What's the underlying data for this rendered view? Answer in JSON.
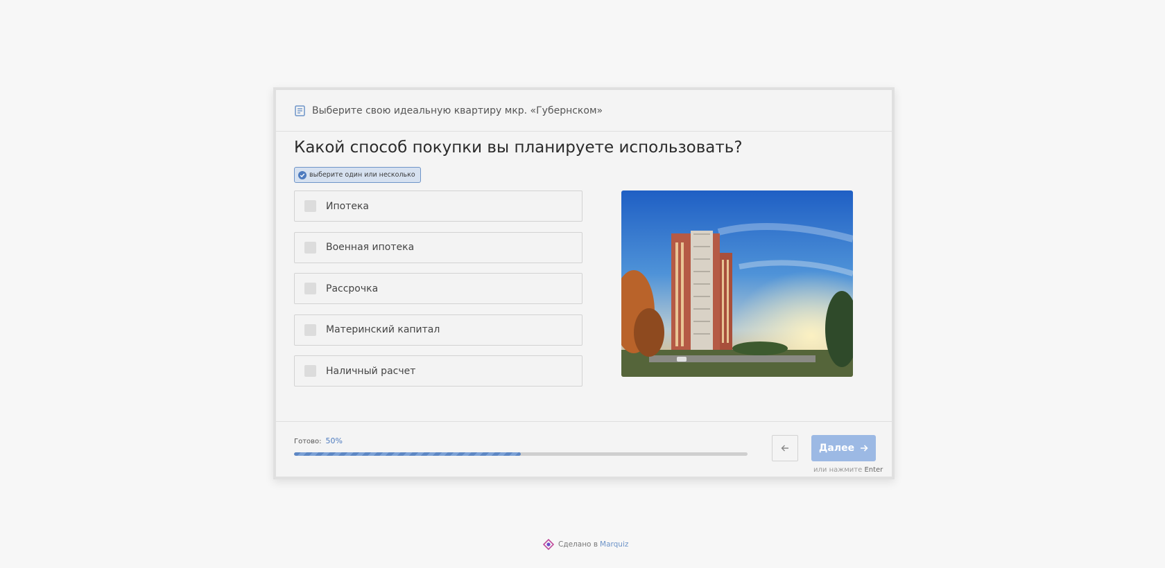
{
  "header": {
    "title": "Выберите свою идеальную квартиру мкр. «Губернском»",
    "icon": "form-list-icon"
  },
  "question": {
    "text": "Какой способ покупки вы планируете использовать?"
  },
  "hint": {
    "text": "выберите один или несколько"
  },
  "options": [
    {
      "label": "Ипотека",
      "checked": false
    },
    {
      "label": "Военная ипотека",
      "checked": false
    },
    {
      "label": "Рассрочка",
      "checked": false
    },
    {
      "label": "Материнский капитал",
      "checked": false
    },
    {
      "label": "Наличный расчет",
      "checked": false
    }
  ],
  "progress": {
    "label": "Готово:",
    "percent_text": "50%",
    "value": 0.5
  },
  "nav": {
    "next_label": "Далее",
    "enter_hint_prefix": "или нажмите",
    "enter_hint_key": "Enter"
  },
  "footer": {
    "made_by": "Сделано в",
    "brand": "Marquiz"
  },
  "colors": {
    "accent": "#4d7bbf",
    "button": "#9cb9e4",
    "background": "#f7f7f7"
  }
}
